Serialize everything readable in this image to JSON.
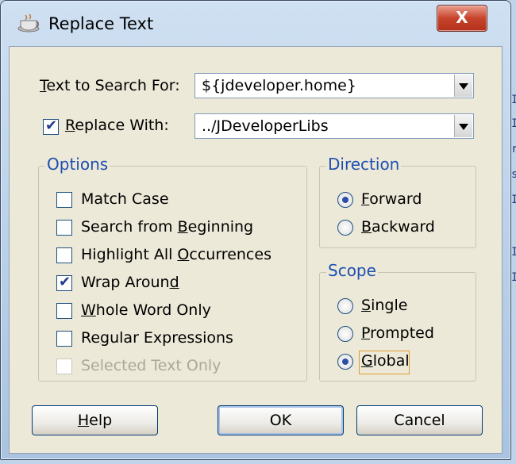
{
  "dialog": {
    "title": "Replace Text",
    "close_label": "X"
  },
  "search": {
    "label_u": "T",
    "label_rest": "ext to Search For:",
    "value": "${jdeveloper.home}"
  },
  "replace": {
    "checked": true,
    "label_u": "R",
    "label_rest": "eplace With:",
    "value": "../JDeveloperLibs"
  },
  "options": {
    "title": "Options",
    "items": [
      {
        "pre": "Match C",
        "u": "",
        "post": "ase",
        "checked": false,
        "enabled": true
      },
      {
        "pre": "Search from ",
        "u": "B",
        "post": "eginning",
        "checked": false,
        "enabled": true
      },
      {
        "pre": "Highlight All ",
        "u": "O",
        "post": "ccurrences",
        "checked": false,
        "enabled": true
      },
      {
        "pre": "Wrap Aroun",
        "u": "d",
        "post": "",
        "checked": true,
        "enabled": true
      },
      {
        "pre": "",
        "u": "W",
        "post": "hole Word Only",
        "checked": false,
        "enabled": true
      },
      {
        "pre": "Re",
        "u": "g",
        "post": "ular Expressions",
        "checked": false,
        "enabled": true
      },
      {
        "pre": "Selected Text Only",
        "u": "",
        "post": "",
        "checked": false,
        "enabled": false
      }
    ]
  },
  "direction": {
    "title": "Direction",
    "items": [
      {
        "u": "F",
        "post": "orward",
        "selected": true
      },
      {
        "u": "B",
        "post": "ackward",
        "selected": false
      }
    ]
  },
  "scope": {
    "title": "Scope",
    "items": [
      {
        "u": "S",
        "post": "ingle",
        "selected": false
      },
      {
        "u": "P",
        "post": "rompted",
        "selected": false
      },
      {
        "u": "G",
        "post": "lobal",
        "selected": true
      }
    ]
  },
  "buttons": {
    "help": {
      "u": "H",
      "post": "elp"
    },
    "ok": "OK",
    "cancel": "Cancel"
  },
  "icons": {
    "app": "coffee-cup-icon",
    "close": "close-icon",
    "dropdown": "chevron-down-icon"
  },
  "colors": {
    "group_title": "#1f4fb0",
    "close_button": "#c8442c",
    "focus": "#e39a2e"
  }
}
